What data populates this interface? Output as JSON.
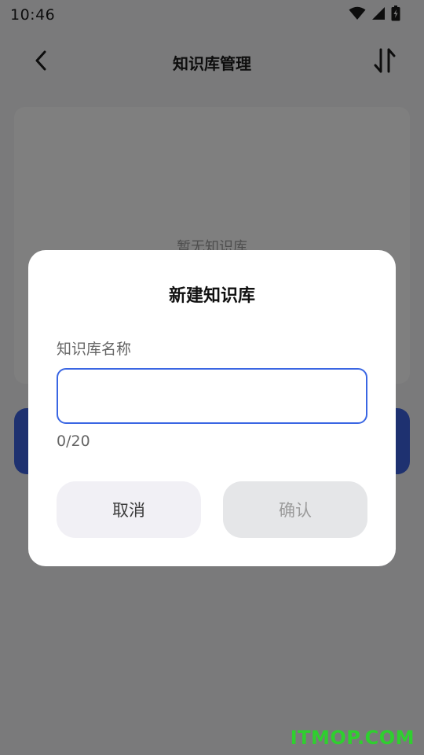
{
  "status_bar": {
    "time": "10:46",
    "icons": [
      "wifi-icon",
      "signal-icon",
      "battery-icon"
    ]
  },
  "app_bar": {
    "title": "知识库管理",
    "back_icon": "chevron-left-icon",
    "sort_icon": "sort-arrows-icon"
  },
  "knowledge_base": {
    "empty_text": "暂无知识库"
  },
  "dialog": {
    "title": "新建知识库",
    "field_label": "知识库名称",
    "input_value": "",
    "input_placeholder": "",
    "counter": "0/20",
    "cancel_label": "取消",
    "confirm_label": "确认"
  },
  "watermark": "ITMOP.COM",
  "colors": {
    "accent": "#3a66e3",
    "primary_button": "#3d63e0",
    "scrim": "rgba(0,0,0,0.5)",
    "watermark": "#2fcf2f"
  }
}
